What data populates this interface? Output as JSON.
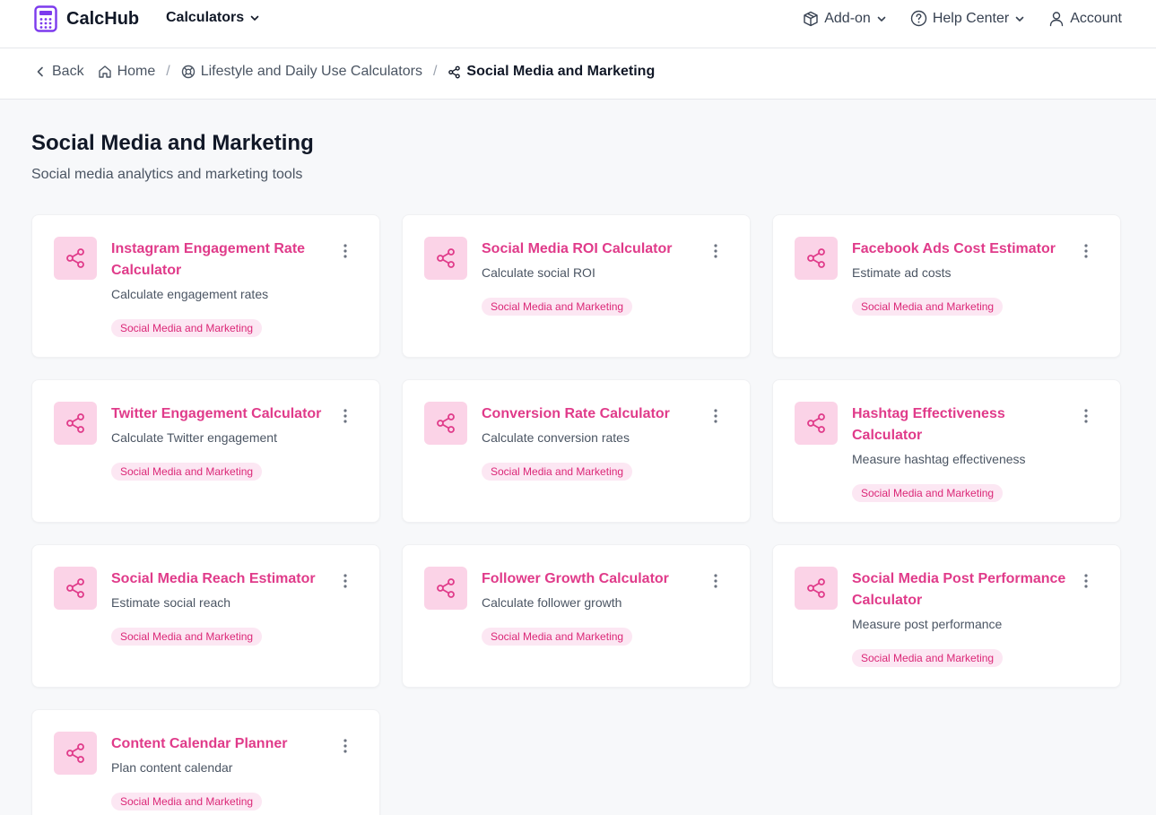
{
  "header": {
    "brand": "CalcHub",
    "calculators_menu": "Calculators",
    "addon": "Add-on",
    "help": "Help Center",
    "account": "Account"
  },
  "breadcrumb": {
    "back": "Back",
    "home": "Home",
    "category": "Lifestyle and Daily Use Calculators",
    "current": "Social Media and Marketing"
  },
  "page": {
    "title": "Social Media and Marketing",
    "subtitle": "Social media analytics and marketing tools"
  },
  "cards": [
    {
      "title": "Instagram Engagement Rate Calculator",
      "description": "Calculate engagement rates",
      "tag": "Social Media and Marketing"
    },
    {
      "title": "Social Media ROI Calculator",
      "description": "Calculate social ROI",
      "tag": "Social Media and Marketing"
    },
    {
      "title": "Facebook Ads Cost Estimator",
      "description": "Estimate ad costs",
      "tag": "Social Media and Marketing"
    },
    {
      "title": "Twitter Engagement Calculator",
      "description": "Calculate Twitter engagement",
      "tag": "Social Media and Marketing"
    },
    {
      "title": "Conversion Rate Calculator",
      "description": "Calculate conversion rates",
      "tag": "Social Media and Marketing"
    },
    {
      "title": "Hashtag Effectiveness Calculator",
      "description": "Measure hashtag effectiveness",
      "tag": "Social Media and Marketing"
    },
    {
      "title": "Social Media Reach Estimator",
      "description": "Estimate social reach",
      "tag": "Social Media and Marketing"
    },
    {
      "title": "Follower Growth Calculator",
      "description": "Calculate follower growth",
      "tag": "Social Media and Marketing"
    },
    {
      "title": "Social Media Post Performance Calculator",
      "description": "Measure post performance",
      "tag": "Social Media and Marketing"
    },
    {
      "title": "Content Calendar Planner",
      "description": "Plan content calendar",
      "tag": "Social Media and Marketing"
    }
  ],
  "colors": {
    "accent": "#e03b8a",
    "brand_icon": "#7c3aed",
    "icon_bg": "#fbd3e7",
    "tag_bg": "#fce7f3"
  },
  "icons": {
    "brand": "calculator-icon",
    "card": "share-icon",
    "card_menu": "more-vertical-icon"
  }
}
